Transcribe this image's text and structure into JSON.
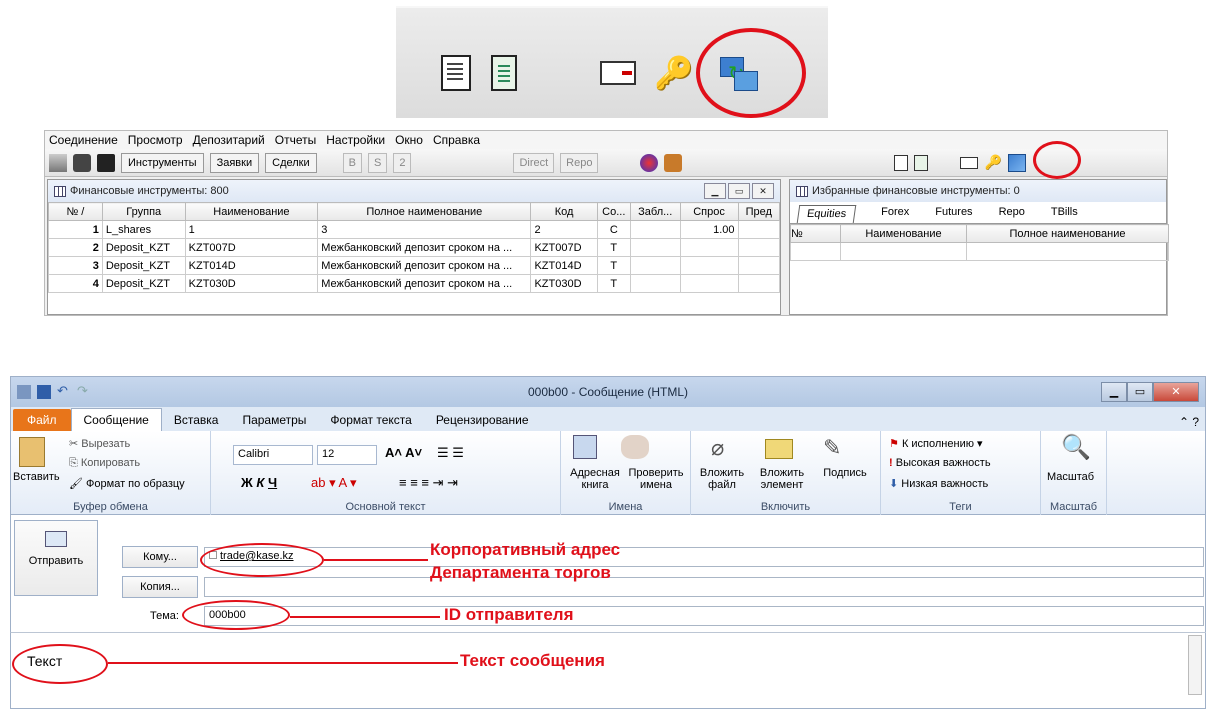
{
  "zoom_toolbar": {
    "icons": [
      "document-icon",
      "notepad-icon",
      "card-icon",
      "key-icon",
      "exchange-icon"
    ]
  },
  "kase": {
    "menu": [
      "Соединение",
      "Просмотр",
      "Депозитарий",
      "Отчеты",
      "Настройки",
      "Окно",
      "Справка"
    ],
    "toolbar": {
      "instruments": "Инструменты",
      "orders": "Заявки",
      "deals": "Сделки",
      "b": "B",
      "s": "S",
      "two": "2",
      "direct": "Direct",
      "repo": "Repo"
    },
    "fin_panel": {
      "title": "Финансовые инструменты: 800",
      "columns": [
        "№ /",
        "Группа",
        "Наименование",
        "Полное наименование",
        "Код",
        "Со...",
        "Забл...",
        "Спрос",
        "Пред"
      ],
      "rows": [
        [
          "1",
          "L_shares",
          "1",
          "3",
          "2",
          "C",
          "",
          "1.00",
          ""
        ],
        [
          "2",
          "Deposit_KZT",
          "KZT007D",
          "Межбанковский депозит сроком на ...",
          "KZT007D",
          "T",
          "",
          "",
          ""
        ],
        [
          "3",
          "Deposit_KZT",
          "KZT014D",
          "Межбанковский депозит сроком на ...",
          "KZT014D",
          "T",
          "",
          "",
          ""
        ],
        [
          "4",
          "Deposit_KZT",
          "KZT030D",
          "Межбанковский депозит сроком на ...",
          "KZT030D",
          "T",
          "",
          "",
          ""
        ]
      ]
    },
    "fav_panel": {
      "title": "Избранные финансовые инструменты: 0",
      "tabs": [
        "Equities",
        "Forex",
        "Futures",
        "Repo",
        "TBills"
      ],
      "columns": [
        "№",
        "Наименование",
        "Полное наименование"
      ]
    }
  },
  "outlook": {
    "title": "000b00 - Сообщение (HTML)",
    "tabs": [
      "Файл",
      "Сообщение",
      "Вставка",
      "Параметры",
      "Формат текста",
      "Рецензирование"
    ],
    "clipboard": {
      "paste": "Вставить",
      "cut": "Вырезать",
      "copy": "Копировать",
      "format_painter": "Формат по образцу",
      "label": "Буфер обмена"
    },
    "font": {
      "name": "Calibri",
      "size": "12",
      "label": "Основной текст"
    },
    "names": {
      "address_book": "Адресная книга",
      "check_names": "Проверить имена",
      "label": "Имена"
    },
    "include": {
      "attach_file": "Вложить файл",
      "attach_item": "Вложить элемент",
      "signature": "Подпись",
      "label": "Включить"
    },
    "tags": {
      "follow_up": "К исполнению",
      "high": "Высокая важность",
      "low": "Низкая важность",
      "label": "Теги"
    },
    "zoom": {
      "button": "Масштаб",
      "label": "Масштаб"
    },
    "send": "Отправить",
    "to_label": "Кому...",
    "cc_label": "Копия...",
    "subject_label": "Тема:",
    "to_value": "trade@kase.kz",
    "subject_value": "000b00",
    "body_text": "Текст"
  },
  "callouts": {
    "corp_address_line1": "Корпоративный адрес",
    "corp_address_line2": "Департамента торгов",
    "sender_id": "ID отправителя",
    "message_text": "Текст сообщения"
  },
  "colors": {
    "annotation_red": "#e0101a",
    "outlook_file_tab": "#e8751a"
  }
}
